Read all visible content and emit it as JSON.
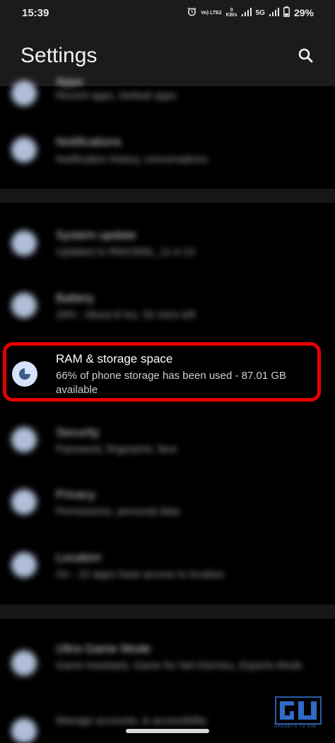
{
  "status_bar": {
    "time": "15:39",
    "volte": "Vo) LTE2",
    "network_speed_value": "0",
    "network_speed_unit": "KB/s",
    "network_type": "5G",
    "battery_percent": "29%"
  },
  "header": {
    "title": "Settings"
  },
  "icons": {
    "search": "search-icon",
    "alarm": "alarm-icon",
    "signal": "signal-icon",
    "battery": "battery-icon",
    "storage": "storage-icon"
  },
  "items": [
    {
      "title": "Apps",
      "subtitle": "Recent apps, Default apps",
      "blurred": true
    },
    {
      "title": "Notifications",
      "subtitle": "Notification history, conversations",
      "blurred": true
    },
    {
      "title": "System update",
      "subtitle": "Updated to RMX3081_11.A.13",
      "blurred": true
    },
    {
      "title": "Battery",
      "subtitle": "29% - About 8 hrs, 52 mins left",
      "blurred": true
    },
    {
      "title": "RAM & storage space",
      "subtitle": "66% of phone storage has been used - 87.01 GB available",
      "blurred": false
    },
    {
      "title": "Security",
      "subtitle": "Password, fingerprint, face",
      "blurred": true
    },
    {
      "title": "Privacy",
      "subtitle": "Permissions, personal data",
      "blurred": true
    },
    {
      "title": "Location",
      "subtitle": "On - 22 apps have access to location",
      "blurred": true
    },
    {
      "title": "Ultra Game Mode",
      "subtitle": "Game Assistant, Game for Net Dismiss, Esports Mode",
      "blurred": true
    },
    {
      "title": "Accounts",
      "subtitle": "Manage accounts, & accessibility",
      "blurred": true
    }
  ],
  "watermark": {
    "text": "GADGETS TO USE"
  },
  "colors": {
    "highlight": "#e50000",
    "icon_bg": "#cfe0ff",
    "background": "#000000",
    "header_bg": "#1b1b1b"
  }
}
